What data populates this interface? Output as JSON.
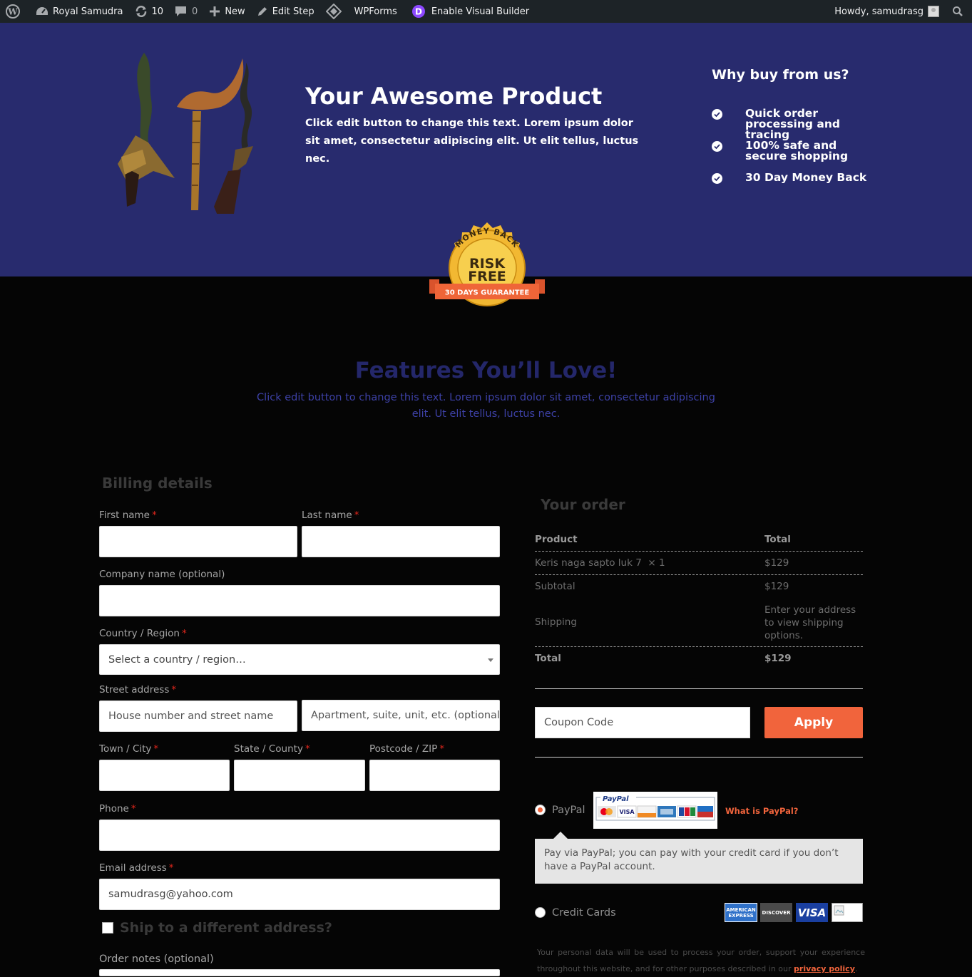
{
  "adminbar": {
    "site_name": "Royal Samudra",
    "updates_count": "10",
    "comments_count": "0",
    "new_label": "New",
    "edit_step_label": "Edit Step",
    "wpforms_label": "WPForms",
    "visual_builder_label": "Enable Visual Builder",
    "howdy_label": "Howdy, samudrasg"
  },
  "hero": {
    "title": "Your Awesome Product",
    "text": "Click edit button to change this text. Lorem ipsum dolor sit amet, consectetur adipiscing elit. Ut elit tellus, luctus nec.",
    "why_title": "Why buy from us?",
    "why_items": [
      "Quick order processing and tracing",
      "100% safe and secure shopping",
      "30 Day Money Back"
    ],
    "badge": {
      "top": "MONEY BACK",
      "line1": "RISK",
      "line2": "FREE",
      "ribbon": "30 DAYS GUARANTEE"
    }
  },
  "features": {
    "title": "Features You’ll Love!",
    "text": "Click edit button to change this text. Lorem ipsum dolor sit amet, consectetur adipiscing elit. Ut elit tellus, luctus nec."
  },
  "billing": {
    "title": "Billing details",
    "first_name_label": "First name",
    "last_name_label": "Last name",
    "company_label": "Company name (optional)",
    "country_label": "Country / Region",
    "country_value": "Select a country / region…",
    "street_label": "Street address",
    "street_placeholder": "House number and street name",
    "apartment_placeholder": "Apartment, suite, unit, etc. (optional",
    "city_label": "Town / City",
    "state_label": "State / County",
    "postcode_label": "Postcode / ZIP",
    "phone_label": "Phone",
    "email_label": "Email address",
    "email_value": "samudrasg@yahoo.com",
    "ship_label": "Ship to a different address?",
    "notes_label": "Order notes (optional)",
    "required_mark": "*"
  },
  "order": {
    "title": "Your order",
    "col_product": "Product",
    "col_total": "Total",
    "item_name": "Keris naga sapto luk 7",
    "item_qty": "× 1",
    "item_total": "$129",
    "subtotal_label": "Subtotal",
    "subtotal_value": "$129",
    "shipping_label": "Shipping",
    "shipping_value": "Enter your address to view shipping options.",
    "total_label": "Total",
    "total_value": "$129",
    "coupon_placeholder": "Coupon Code",
    "apply_label": "Apply"
  },
  "payment": {
    "paypal_label": "PayPal",
    "paypal_logo_text": "PayPal",
    "what_is_paypal": "What is PayPal?",
    "paypal_desc": "Pay via PayPal; you can pay with your credit card if you don’t have a PayPal account.",
    "credit_label": "Credit Cards",
    "cards": [
      "AMERICAN EXPRESS",
      "DISCOVER",
      "VISA"
    ],
    "privacy_text": "Your personal data will be used to process your order, support your experience throughout this website, and for other purposes described in our",
    "privacy_link": "privacy policy",
    "privacy_end": "."
  },
  "colors": {
    "hero_bg": "#282b6e",
    "accent": "#f1643c",
    "adminbar_bg": "#1d2327"
  }
}
